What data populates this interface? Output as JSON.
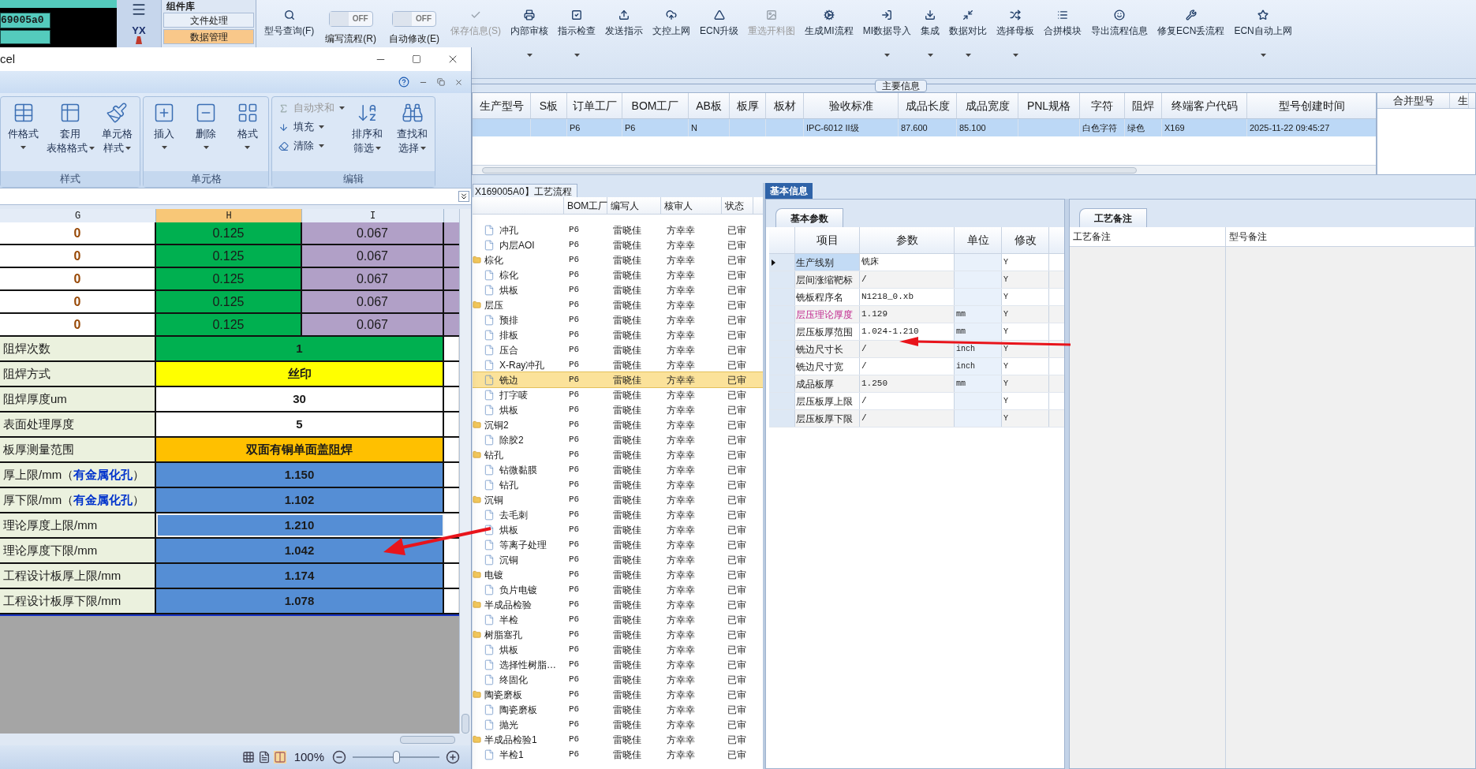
{
  "left_cell": "69005a0",
  "sidebar": {
    "logo_text": "YX"
  },
  "component_panel": {
    "title": "组件库",
    "buttons": [
      {
        "label": "文件处理",
        "selected": false
      },
      {
        "label": "数据管理",
        "selected": true
      }
    ]
  },
  "toolbar": [
    {
      "kind": "button",
      "label": "型号查询(F)",
      "disabled": false,
      "dropdown": false
    },
    {
      "kind": "toggle",
      "label": "编写流程(R)",
      "state_text": "OFF",
      "on": false
    },
    {
      "kind": "toggle",
      "label": "自动修改(E)",
      "state_text": "OFF",
      "on": false
    },
    {
      "kind": "button",
      "label": "保存信息(S)",
      "disabled": true,
      "dropdown": false
    },
    {
      "kind": "button",
      "label": "内部审核",
      "disabled": false,
      "dropdown": true
    },
    {
      "kind": "button",
      "label": "指示检查",
      "disabled": false,
      "dropdown": true
    },
    {
      "kind": "button",
      "label": "发送指示",
      "disabled": false,
      "dropdown": false
    },
    {
      "kind": "button",
      "label": "文控上网",
      "disabled": false,
      "dropdown": false
    },
    {
      "kind": "button",
      "label": "ECN升级",
      "disabled": false,
      "dropdown": false
    },
    {
      "kind": "button",
      "label": "重选开料图",
      "disabled": true,
      "dropdown": false
    },
    {
      "kind": "button",
      "label": "生成MI流程",
      "disabled": false,
      "dropdown": false
    },
    {
      "kind": "button",
      "label": "MI数据导入",
      "disabled": false,
      "dropdown": true
    },
    {
      "kind": "button",
      "label": "集成",
      "disabled": false,
      "dropdown": true
    },
    {
      "kind": "button",
      "label": "数据对比",
      "disabled": false,
      "dropdown": true
    },
    {
      "kind": "button",
      "label": "选择母板",
      "disabled": false,
      "dropdown": true
    },
    {
      "kind": "button",
      "label": "合拼模块",
      "disabled": false,
      "dropdown": false
    },
    {
      "kind": "button",
      "label": "导出流程信息",
      "disabled": false,
      "dropdown": false
    },
    {
      "kind": "button",
      "label": "修复ECN丢流程",
      "disabled": false,
      "dropdown": false
    },
    {
      "kind": "button",
      "label": "ECN自动上网",
      "disabled": false,
      "dropdown": true
    }
  ],
  "main_info": {
    "title": "主要信息",
    "row_selected": true,
    "columns": [
      {
        "label": "生产型号"
      },
      {
        "label": "S板"
      },
      {
        "label": "订单工厂",
        "value": "P6"
      },
      {
        "label": "BOM工厂",
        "value": "P6"
      },
      {
        "label": "AB板",
        "value": "N"
      },
      {
        "label": "板厚"
      },
      {
        "label": "板材"
      },
      {
        "label": "验收标准",
        "value": "IPC-6012 II级"
      },
      {
        "label": "成品长度",
        "value": "87.600"
      },
      {
        "label": "成品宽度",
        "value": "85.100"
      },
      {
        "label": "PNL规格"
      },
      {
        "label": "字符",
        "value": "白色字符"
      },
      {
        "label": "阻焊",
        "value": "绿色"
      },
      {
        "label": "终端客户代码",
        "value": "X169"
      },
      {
        "label": "型号创建时间",
        "value": "2025-11-22 09:45:27"
      }
    ],
    "side_columns": [
      "合并型号",
      "生"
    ]
  },
  "process_tree": {
    "tab": "X169005A0】工艺流程",
    "columns": [
      "BOM工厂",
      "编写人",
      "核审人",
      "状态"
    ],
    "rows": [
      {
        "children": [
          {
            "name": "冲孔",
            "bom": "P6",
            "writer": "雷晓佳",
            "reviewer": "方幸幸",
            "status": "已审",
            "selected": false
          },
          {
            "name": "内层AOI",
            "bom": "P6",
            "writer": "雷晓佳",
            "reviewer": "方幸幸",
            "status": "已审",
            "selected": false
          }
        ]
      },
      {
        "name": "棕化",
        "bom": "P6",
        "writer": "雷晓佳",
        "reviewer": "方幸幸",
        "status": "已审",
        "selected": false,
        "children": [
          {
            "name": "棕化",
            "bom": "P6",
            "writer": "雷晓佳",
            "reviewer": "方幸幸",
            "status": "已审",
            "selected": false
          },
          {
            "name": "烘板",
            "bom": "P6",
            "writer": "雷晓佳",
            "reviewer": "方幸幸",
            "status": "已审",
            "selected": false
          }
        ]
      },
      {
        "name": "层压",
        "bom": "P6",
        "writer": "雷晓佳",
        "reviewer": "方幸幸",
        "status": "已审",
        "selected": false,
        "children": [
          {
            "name": "预排",
            "bom": "P6",
            "writer": "雷晓佳",
            "reviewer": "方幸幸",
            "status": "已审",
            "selected": false
          },
          {
            "name": "排板",
            "bom": "P6",
            "writer": "雷晓佳",
            "reviewer": "方幸幸",
            "status": "已审",
            "selected": false
          },
          {
            "name": "压合",
            "bom": "P6",
            "writer": "雷晓佳",
            "reviewer": "方幸幸",
            "status": "已审",
            "selected": false
          },
          {
            "name": "X-Ray冲孔",
            "bom": "P6",
            "writer": "雷晓佳",
            "reviewer": "方幸幸",
            "status": "已审",
            "selected": false
          },
          {
            "name": "铣边",
            "bom": "P6",
            "writer": "雷晓佳",
            "reviewer": "方幸幸",
            "status": "已审",
            "selected": true
          },
          {
            "name": "打字唛",
            "bom": "P6",
            "writer": "雷晓佳",
            "reviewer": "方幸幸",
            "status": "已审",
            "selected": false
          },
          {
            "name": "烘板",
            "bom": "P6",
            "writer": "雷晓佳",
            "reviewer": "方幸幸",
            "status": "已审",
            "selected": false
          }
        ]
      },
      {
        "name": "沉铜2",
        "bom": "P6",
        "writer": "雷晓佳",
        "reviewer": "方幸幸",
        "status": "已审",
        "selected": false,
        "children": [
          {
            "name": "除胶2",
            "bom": "P6",
            "writer": "雷晓佳",
            "reviewer": "方幸幸",
            "status": "已审",
            "selected": false
          }
        ]
      },
      {
        "name": "钻孔",
        "bom": "P6",
        "writer": "雷晓佳",
        "reviewer": "方幸幸",
        "status": "已审",
        "selected": false,
        "children": [
          {
            "name": "钻微黏膜",
            "bom": "P6",
            "writer": "雷晓佳",
            "reviewer": "方幸幸",
            "status": "已审",
            "selected": false
          },
          {
            "name": "钻孔",
            "bom": "P6",
            "writer": "雷晓佳",
            "reviewer": "方幸幸",
            "status": "已审",
            "selected": false
          }
        ]
      },
      {
        "name": "沉铜",
        "bom": "P6",
        "writer": "雷晓佳",
        "reviewer": "方幸幸",
        "status": "已审",
        "selected": false,
        "children": [
          {
            "name": "去毛刺",
            "bom": "P6",
            "writer": "雷晓佳",
            "reviewer": "方幸幸",
            "status": "已审",
            "selected": false
          },
          {
            "name": "烘板",
            "bom": "P6",
            "writer": "雷晓佳",
            "reviewer": "方幸幸",
            "status": "已审",
            "selected": false
          },
          {
            "name": "等离子处理",
            "bom": "P6",
            "writer": "雷晓佳",
            "reviewer": "方幸幸",
            "status": "已审",
            "selected": false
          },
          {
            "name": "沉铜",
            "bom": "P6",
            "writer": "雷晓佳",
            "reviewer": "方幸幸",
            "status": "已审",
            "selected": false
          }
        ]
      },
      {
        "name": "电镀",
        "bom": "P6",
        "writer": "雷晓佳",
        "reviewer": "方幸幸",
        "status": "已审",
        "selected": false,
        "children": [
          {
            "name": "负片电镀",
            "bom": "P6",
            "writer": "雷晓佳",
            "reviewer": "方幸幸",
            "status": "已审",
            "selected": false
          }
        ]
      },
      {
        "name": "半成品检验",
        "bom": "P6",
        "writer": "雷晓佳",
        "reviewer": "方幸幸",
        "status": "已审",
        "selected": false,
        "children": [
          {
            "name": "半检",
            "bom": "P6",
            "writer": "雷晓佳",
            "reviewer": "方幸幸",
            "status": "已审",
            "selected": false
          }
        ]
      },
      {
        "name": "树脂塞孔",
        "bom": "P6",
        "writer": "雷晓佳",
        "reviewer": "方幸幸",
        "status": "已审",
        "selected": false,
        "children": [
          {
            "name": "烘板",
            "bom": "P6",
            "writer": "雷晓佳",
            "reviewer": "方幸幸",
            "status": "已审",
            "selected": false
          },
          {
            "name": "选择性树脂…",
            "bom": "P6",
            "writer": "雷晓佳",
            "reviewer": "方幸幸",
            "status": "已审",
            "selected": false
          },
          {
            "name": "终固化",
            "bom": "P6",
            "writer": "雷晓佳",
            "reviewer": "方幸幸",
            "status": "已审",
            "selected": false
          }
        ]
      },
      {
        "name": "陶瓷磨板",
        "bom": "P6",
        "writer": "雷晓佳",
        "reviewer": "方幸幸",
        "status": "已审",
        "selected": false,
        "children": [
          {
            "name": "陶瓷磨板",
            "bom": "P6",
            "writer": "雷晓佳",
            "reviewer": "方幸幸",
            "status": "已审",
            "selected": false
          },
          {
            "name": "抛光",
            "bom": "P6",
            "writer": "雷晓佳",
            "reviewer": "方幸幸",
            "status": "已审",
            "selected": false
          }
        ]
      },
      {
        "name": "半成品检验1",
        "bom": "P6",
        "writer": "雷晓佳",
        "reviewer": "方幸幸",
        "status": "已审",
        "selected": false,
        "children": [
          {
            "name": "半检1",
            "bom": "P6",
            "writer": "雷晓佳",
            "reviewer": "方幸幸",
            "status": "已审",
            "selected": false
          }
        ]
      }
    ]
  },
  "basic_info": {
    "tab": "基本信息",
    "params": {
      "tab": "基本参数",
      "columns": [
        "项目",
        "参数",
        "单位",
        "修改"
      ],
      "rows": [
        {
          "item": "生产线别",
          "value": "铣床",
          "modify": "Y",
          "selected": true,
          "emphasized": false
        },
        {
          "item": "层间涨缩靶标",
          "value": "/",
          "modify": "Y",
          "selected": false,
          "emphasized": false
        },
        {
          "item": "铣板程序名",
          "value": "N1218_0.xb",
          "modify": "Y",
          "selected": false,
          "emphasized": false
        },
        {
          "item": "层压理论厚度",
          "value": "1.129",
          "unit": "mm",
          "modify": "Y",
          "selected": false,
          "emphasized": true
        },
        {
          "item": "层压板厚范围",
          "value": "1.024-1.210",
          "unit": "mm",
          "modify": "Y",
          "selected": false,
          "emphasized": false
        },
        {
          "item": "铣边尺寸长",
          "value": "/",
          "unit": "inch",
          "modify": "Y",
          "selected": false,
          "emphasized": false
        },
        {
          "item": "铣边尺寸宽",
          "value": "/",
          "unit": "inch",
          "modify": "Y",
          "selected": false,
          "emphasized": false
        },
        {
          "item": "成品板厚",
          "value": "1.250",
          "unit": "mm",
          "modify": "Y",
          "selected": false,
          "emphasized": false
        },
        {
          "item": "层压板厚上限",
          "value": "/",
          "modify": "Y",
          "selected": false,
          "emphasized": false
        },
        {
          "item": "层压板厚下限",
          "value": "/",
          "modify": "Y",
          "selected": false,
          "emphasized": false
        }
      ]
    },
    "notes": {
      "tab": "工艺备注",
      "columns": [
        "工艺备注",
        "型号备注"
      ]
    }
  },
  "excel": {
    "title": "cel",
    "ribbon_groups": [
      {
        "label": "样式",
        "items": [
          {
            "lines": [
              "件格式"
            ],
            "kind": "large",
            "disabled": false,
            "dropdown": true
          },
          {
            "lines": [
              "套用",
              "表格格式"
            ],
            "kind": "large",
            "disabled": false,
            "dropdown": true
          },
          {
            "lines": [
              "单元格",
              "样式"
            ],
            "kind": "large",
            "disabled": false,
            "dropdown": true
          }
        ]
      },
      {
        "label": "单元格",
        "items": [
          {
            "lines": [
              "插入"
            ],
            "kind": "large",
            "disabled": false,
            "dropdown": true
          },
          {
            "lines": [
              "删除"
            ],
            "kind": "large",
            "disabled": false,
            "dropdown": true
          },
          {
            "lines": [
              "格式"
            ],
            "kind": "large",
            "disabled": false,
            "dropdown": true
          }
        ]
      },
      {
        "label": "编辑",
        "items": [
          {
            "lines": [
              "自动求和"
            ],
            "kind": "small",
            "disabled": true,
            "dropdown": true
          },
          {
            "lines": [
              "填充"
            ],
            "kind": "small",
            "disabled": false,
            "dropdown": true
          },
          {
            "lines": [
              "清除"
            ],
            "kind": "small",
            "disabled": false,
            "dropdown": true
          },
          {
            "lines": [
              "排序和",
              "筛选"
            ],
            "kind": "large",
            "disabled": false,
            "dropdown": true
          },
          {
            "lines": [
              "查找和",
              "选择"
            ],
            "kind": "large",
            "disabled": false,
            "dropdown": true
          }
        ]
      }
    ],
    "columns": [
      {
        "label": "G",
        "selected": false
      },
      {
        "label": "H",
        "selected": true
      },
      {
        "label": "I",
        "selected": false
      }
    ],
    "rows": [
      {
        "kind": "triple",
        "cells": [
          {
            "text": "0"
          },
          {
            "text": "0.125",
            "color": "#00b050"
          },
          {
            "text": "0.067",
            "color": "#b1a0c7"
          }
        ]
      },
      {
        "kind": "triple",
        "cells": [
          {
            "text": "0"
          },
          {
            "text": "0.125",
            "color": "#00b050"
          },
          {
            "text": "0.067",
            "color": "#b1a0c7"
          }
        ]
      },
      {
        "kind": "triple",
        "cells": [
          {
            "text": "0"
          },
          {
            "text": "0.125",
            "color": "#00b050"
          },
          {
            "text": "0.067",
            "color": "#b1a0c7"
          }
        ]
      },
      {
        "kind": "triple",
        "cells": [
          {
            "text": "0"
          },
          {
            "text": "0.125",
            "color": "#00b050"
          },
          {
            "text": "0.067",
            "color": "#b1a0c7"
          }
        ]
      },
      {
        "kind": "triple",
        "cells": [
          {
            "text": "0"
          },
          {
            "text": "0.125",
            "color": "#00b050"
          },
          {
            "text": "0.067",
            "color": "#b1a0c7"
          }
        ]
      },
      {
        "kind": "merged",
        "label": "阻焊次数",
        "value": "1",
        "color": "#00b050",
        "selected": false
      },
      {
        "kind": "merged",
        "label": "阻焊方式",
        "value": "丝印",
        "color": "#ffff00",
        "selected": false
      },
      {
        "kind": "merged",
        "label": "阻焊厚度um",
        "value": "30",
        "color": "#ffffff",
        "selected": false
      },
      {
        "kind": "merged",
        "label": "表面处理厚度",
        "value": "5",
        "color": "#ffffff",
        "selected": false
      },
      {
        "kind": "merged",
        "label": "板厚测量范围",
        "value": "双面有铜单面盖阻焊",
        "color": "#ffc000",
        "selected": false
      },
      {
        "kind": "merged",
        "label": "厚上限/mm（",
        "note": "有金属化孔",
        "tail": "）",
        "value": "1.150",
        "color": "#558ed5",
        "selected": false
      },
      {
        "kind": "merged",
        "label": "厚下限/mm（",
        "note": "有金属化孔",
        "tail": "）",
        "value": "1.102",
        "color": "#558ed5",
        "selected": false
      },
      {
        "kind": "merged",
        "label": "理论厚度上限/mm",
        "value": "1.210",
        "color": "#558ed5",
        "selected": true
      },
      {
        "kind": "merged",
        "label": "理论厚度下限/mm",
        "value": "1.042",
        "color": "#558ed5",
        "selected": false
      },
      {
        "kind": "merged",
        "label": "工程设计板厚上限/mm",
        "value": "1.174",
        "color": "#558ed5",
        "selected": false
      },
      {
        "kind": "merged",
        "label": "工程设计板厚下限/mm",
        "value": "1.078",
        "color": "#558ed5",
        "selected": false
      }
    ],
    "zoom": "100%",
    "zoom_slider": {
      "level": 0.5
    }
  }
}
